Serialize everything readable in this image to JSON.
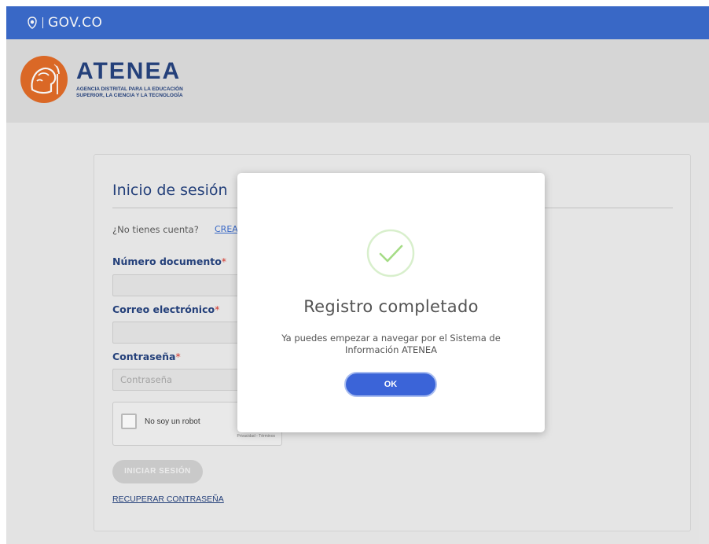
{
  "govbar": {
    "logo_text": "GOV.CO"
  },
  "header": {
    "brand_name": "ATENEA",
    "brand_subtitle_line1": "AGENCIA DISTRITAL PARA LA EDUCACIÓN",
    "brand_subtitle_line2": "SUPERIOR, LA CIENCIA Y LA TECNOLOGÍA"
  },
  "login": {
    "title": "Inicio de sesión",
    "no_account": "¿No tienes cuenta?",
    "create_link": "CREA",
    "doc_label": "Número documento",
    "email_label": "Correo electrónico",
    "password_label": "Contraseña",
    "password_placeholder": "Contraseña",
    "required_mark": "*",
    "captcha_label": "No soy un robot",
    "captcha_links": "Privacidad - Términos",
    "login_button": "INICIAR SESIÓN",
    "recover_link": "RECUPERAR CONTRASEÑA"
  },
  "modal": {
    "title": "Registro completado",
    "message_line1": "Ya puedes empezar a navegar por el Sistema de",
    "message_line2": "Información ATENEA",
    "ok_label": "OK"
  },
  "colors": {
    "gov_blue": "#3366cc",
    "brand_navy": "#1d3b7a",
    "brand_orange": "#e2661f",
    "success_green": "#a5dc86",
    "ok_button": "#3b64d8"
  }
}
